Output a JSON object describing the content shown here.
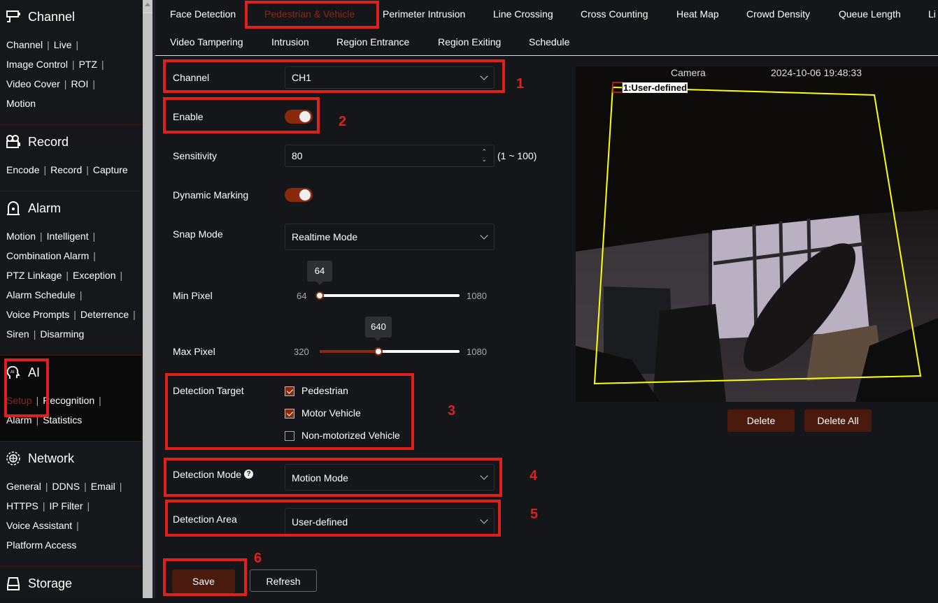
{
  "sidebar": {
    "sections": [
      {
        "title": "Channel",
        "icon": "camera-icon",
        "links": [
          "Channel",
          "Live",
          "Image Control",
          "PTZ",
          "Video Cover",
          "ROI",
          "Motion"
        ]
      },
      {
        "title": "Record",
        "icon": "video-recorder-icon",
        "links": [
          "Encode",
          "Record",
          "Capture"
        ]
      },
      {
        "title": "Alarm",
        "icon": "alarm-light-icon",
        "links": [
          "Motion",
          "Intelligent",
          "Combination Alarm",
          "PTZ Linkage",
          "Exception",
          "Alarm Schedule",
          "Voice Prompts",
          "Deterrence",
          "Siren",
          "Disarming"
        ]
      },
      {
        "title": "AI",
        "icon": "ai-head-icon",
        "links": [
          "Setup",
          "Recognition",
          "Alarm",
          "Statistics"
        ],
        "active_link": "Setup"
      },
      {
        "title": "Network",
        "icon": "globe-icon",
        "links": [
          "General",
          "DDNS",
          "Email",
          "HTTPS",
          "IP Filter",
          "Voice Assistant",
          "Platform Access"
        ]
      },
      {
        "title": "Storage",
        "icon": "hard-drive-icon",
        "links": []
      }
    ]
  },
  "tabs": [
    "Face Detection",
    "Pedestrian & Vehicle",
    "Perimeter Intrusion",
    "Line Crossing",
    "Cross Counting",
    "Heat Map",
    "Crowd Density",
    "Queue Length",
    "Li",
    "Video Tampering",
    "Intrusion",
    "Region Entrance",
    "Region Exiting",
    "Schedule"
  ],
  "selected_tab": "Pedestrian & Vehicle",
  "form": {
    "channel": {
      "label": "Channel",
      "value": "CH1"
    },
    "enable": {
      "label": "Enable",
      "on": true
    },
    "sensitivity": {
      "label": "Sensitivity",
      "value": "80",
      "range": "(1 ~ 100)"
    },
    "dynamic_marking": {
      "label": "Dynamic Marking",
      "on": true
    },
    "snap_mode": {
      "label": "Snap Mode",
      "value": "Realtime Mode"
    },
    "min_pixel": {
      "label": "Min Pixel",
      "value": "64",
      "min": "64",
      "max": "1080"
    },
    "max_pixel": {
      "label": "Max Pixel",
      "value": "640",
      "min": "320",
      "max": "1080"
    },
    "detection_target": {
      "label": "Detection Target",
      "options": [
        {
          "label": "Pedestrian",
          "checked": true
        },
        {
          "label": "Motor Vehicle",
          "checked": true
        },
        {
          "label": "Non-motorized Vehicle",
          "checked": false
        }
      ]
    },
    "detection_mode": {
      "label": "Detection Mode",
      "value": "Motion Mode",
      "help_icon": "question-circle-icon"
    },
    "detection_area": {
      "label": "Detection Area",
      "value": "User-defined"
    },
    "save": "Save",
    "refresh": "Refresh"
  },
  "camera": {
    "name": "Camera",
    "timestamp": "2024-10-06 19:48:33",
    "region_label": "1:User-defined",
    "delete": "Delete",
    "delete_all": "Delete All"
  },
  "annotations": [
    "1",
    "2",
    "3",
    "4",
    "5",
    "6"
  ],
  "colors": {
    "accent": "#8a2a0c",
    "annotation": "#e0201a",
    "region": "#ffff00"
  }
}
